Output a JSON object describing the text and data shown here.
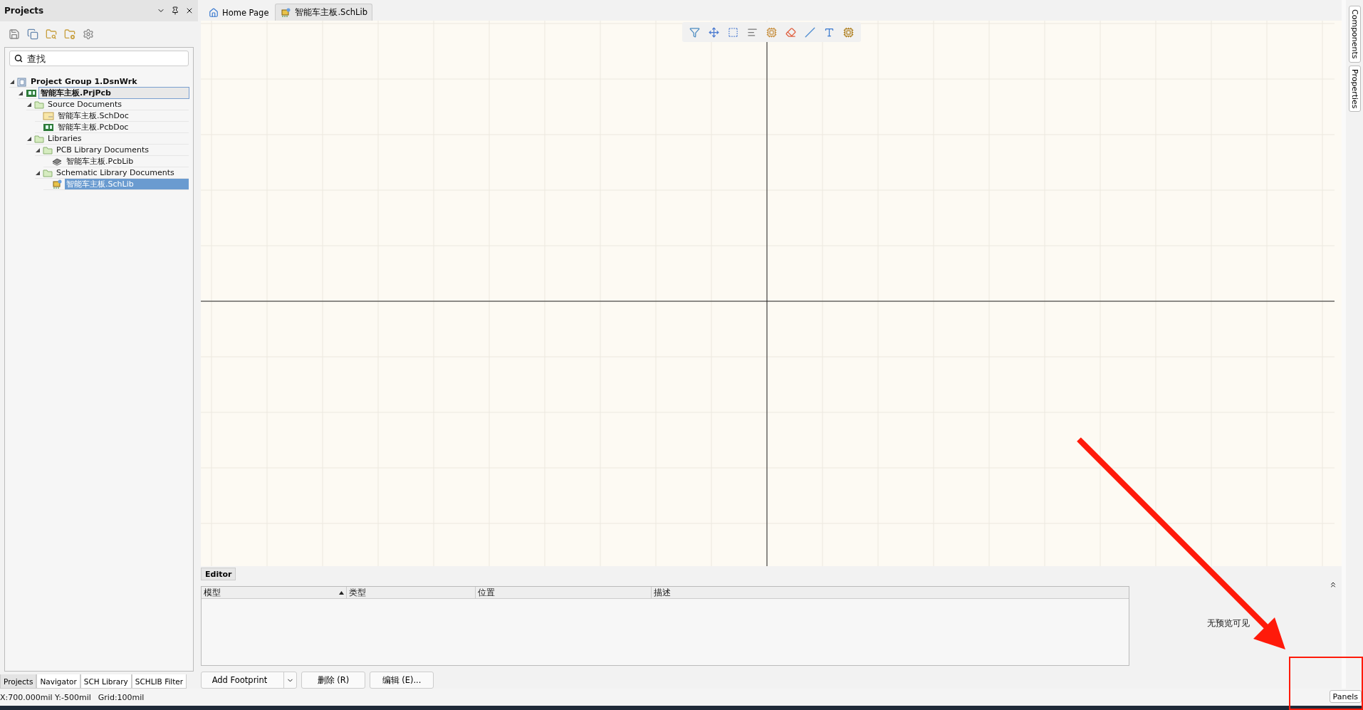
{
  "projects_panel": {
    "title": "Projects",
    "search": {
      "placeholder": "查找"
    },
    "tree": [
      {
        "label": "Project Group 1.DsnWrk",
        "kind": "group",
        "bold": true,
        "selected": false,
        "focused": false,
        "expanded": true,
        "children": [
          {
            "label": "智能车主板.PrjPcb",
            "kind": "project",
            "bold": true,
            "selected": false,
            "focused": true,
            "expanded": true,
            "children": [
              {
                "label": "Source Documents",
                "kind": "folder",
                "bold": false,
                "selected": false,
                "focused": false,
                "expanded": true,
                "children": [
                  {
                    "label": "智能车主板.SchDoc",
                    "kind": "schdoc",
                    "bold": false,
                    "selected": false,
                    "focused": false
                  },
                  {
                    "label": "智能车主板.PcbDoc",
                    "kind": "pcbdoc",
                    "bold": false,
                    "selected": false,
                    "focused": false
                  }
                ]
              },
              {
                "label": "Libraries",
                "kind": "folder",
                "bold": false,
                "selected": false,
                "focused": false,
                "expanded": true,
                "children": [
                  {
                    "label": "PCB Library Documents",
                    "kind": "folder",
                    "bold": false,
                    "selected": false,
                    "focused": false,
                    "expanded": true,
                    "children": [
                      {
                        "label": "智能车主板.PcbLib",
                        "kind": "pcblib",
                        "bold": false,
                        "selected": false,
                        "focused": false
                      }
                    ]
                  },
                  {
                    "label": "Schematic Library Documents",
                    "kind": "folder",
                    "bold": false,
                    "selected": false,
                    "focused": false,
                    "expanded": true,
                    "children": [
                      {
                        "label": "智能车主板.SchLib",
                        "kind": "schlib",
                        "bold": false,
                        "selected": true,
                        "focused": false
                      }
                    ]
                  }
                ]
              }
            ]
          }
        ]
      }
    ],
    "tabs": [
      {
        "label": "Projects",
        "selected": true
      },
      {
        "label": "Navigator",
        "selected": false
      },
      {
        "label": "SCH Library",
        "selected": false
      },
      {
        "label": "SCHLIB Filter",
        "selected": false
      }
    ]
  },
  "doc_tabs": [
    {
      "label": "Home Page",
      "kind": "home",
      "selected": false
    },
    {
      "label": "智能车主板.SchLib",
      "kind": "schlib",
      "selected": true
    }
  ],
  "editor": {
    "tab": "Editor",
    "columns": [
      {
        "label": "模型",
        "sorted": true
      },
      {
        "label": "类型",
        "sorted": false
      },
      {
        "label": "位置",
        "sorted": false
      },
      {
        "label": "描述",
        "sorted": false
      }
    ],
    "buttons": [
      {
        "label": "Add Footprint",
        "kind": "split"
      },
      {
        "label": "删除 (R)",
        "kind": "plain"
      },
      {
        "label": "编辑 (E)...",
        "kind": "plain"
      }
    ]
  },
  "preview": {
    "text": "无预览可见"
  },
  "side_tabs": [
    "Components",
    "Properties"
  ],
  "panels_button": "Panels",
  "status_bar": {
    "position": "X:700.000mil Y:-500mil",
    "grid": "Grid:100mil"
  }
}
